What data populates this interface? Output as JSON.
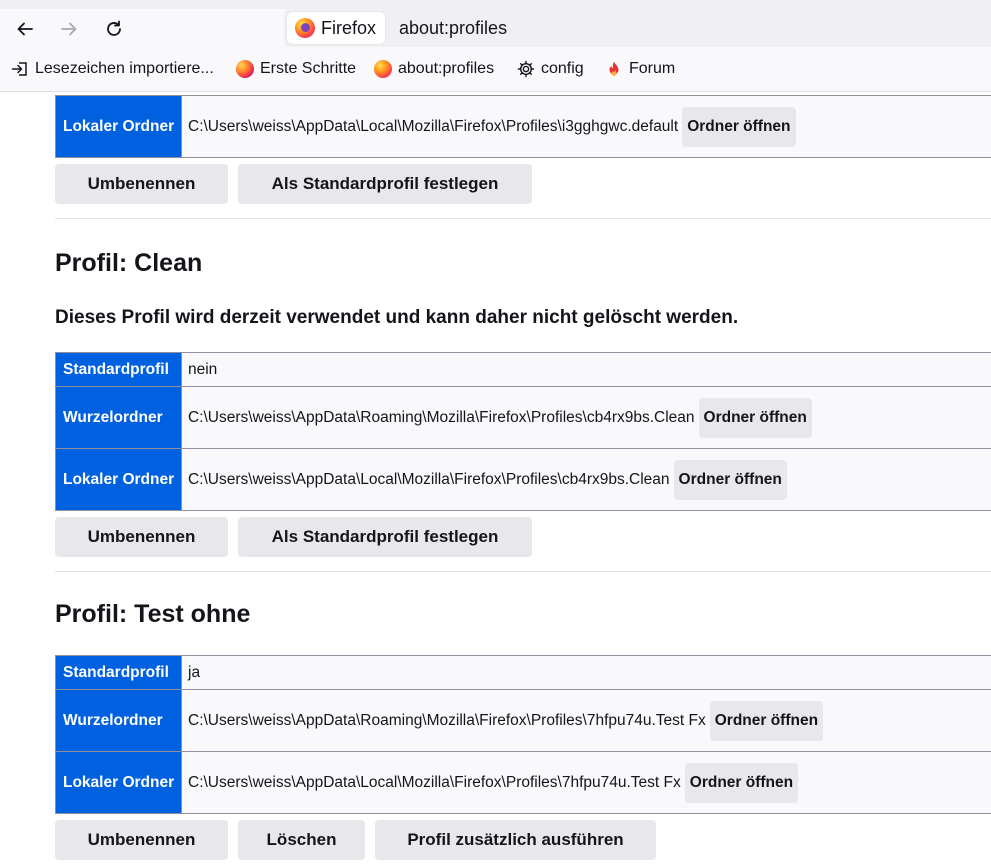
{
  "browser": {
    "identity_label": "Firefox",
    "url": "about:profiles",
    "bookmarks": [
      {
        "label": "Lesezeichen importiere...",
        "icon": "import-icon"
      },
      {
        "label": "Erste Schritte",
        "icon": "firefox-icon"
      },
      {
        "label": "about:profiles",
        "icon": "firefox-icon"
      },
      {
        "label": "config",
        "icon": "gear-icon"
      },
      {
        "label": "Forum",
        "icon": "flame-icon"
      }
    ]
  },
  "profiles": [
    {
      "local_label": "Lokaler Ordner",
      "local_path": "C:\\Users\\weiss\\AppData\\Local\\Mozilla\\Firefox\\Profiles\\i3gghgwc.default",
      "open_label": "Ordner öffnen",
      "actions": [
        "Umbenennen",
        "Als Standardprofil festlegen"
      ]
    },
    {
      "title": "Profil: Clean",
      "note": "Dieses Profil wird derzeit verwendet und kann daher nicht gelöscht werden.",
      "default_label": "Standardprofil",
      "default_value": "nein",
      "root_label": "Wurzelordner",
      "root_path": "C:\\Users\\weiss\\AppData\\Roaming\\Mozilla\\Firefox\\Profiles\\cb4rx9bs.Clean",
      "local_label": "Lokaler Ordner",
      "local_path": "C:\\Users\\weiss\\AppData\\Local\\Mozilla\\Firefox\\Profiles\\cb4rx9bs.Clean",
      "open_label": "Ordner öffnen",
      "actions": [
        "Umbenennen",
        "Als Standardprofil festlegen"
      ]
    },
    {
      "title": "Profil: Test ohne",
      "default_label": "Standardprofil",
      "default_value": "ja",
      "root_label": "Wurzelordner",
      "root_path": "C:\\Users\\weiss\\AppData\\Roaming\\Mozilla\\Firefox\\Profiles\\7hfpu74u.Test Fx",
      "local_label": "Lokaler Ordner",
      "local_path": "C:\\Users\\weiss\\AppData\\Local\\Mozilla\\Firefox\\Profiles\\7hfpu74u.Test Fx",
      "open_label": "Ordner öffnen",
      "actions": [
        "Umbenennen",
        "Löschen",
        "Profil zusätzlich ausführen"
      ]
    }
  ],
  "colors": {
    "header_cell": "#0061e0",
    "button_bg": "#e8e8ec",
    "chrome_bg": "#f9f9fb"
  }
}
